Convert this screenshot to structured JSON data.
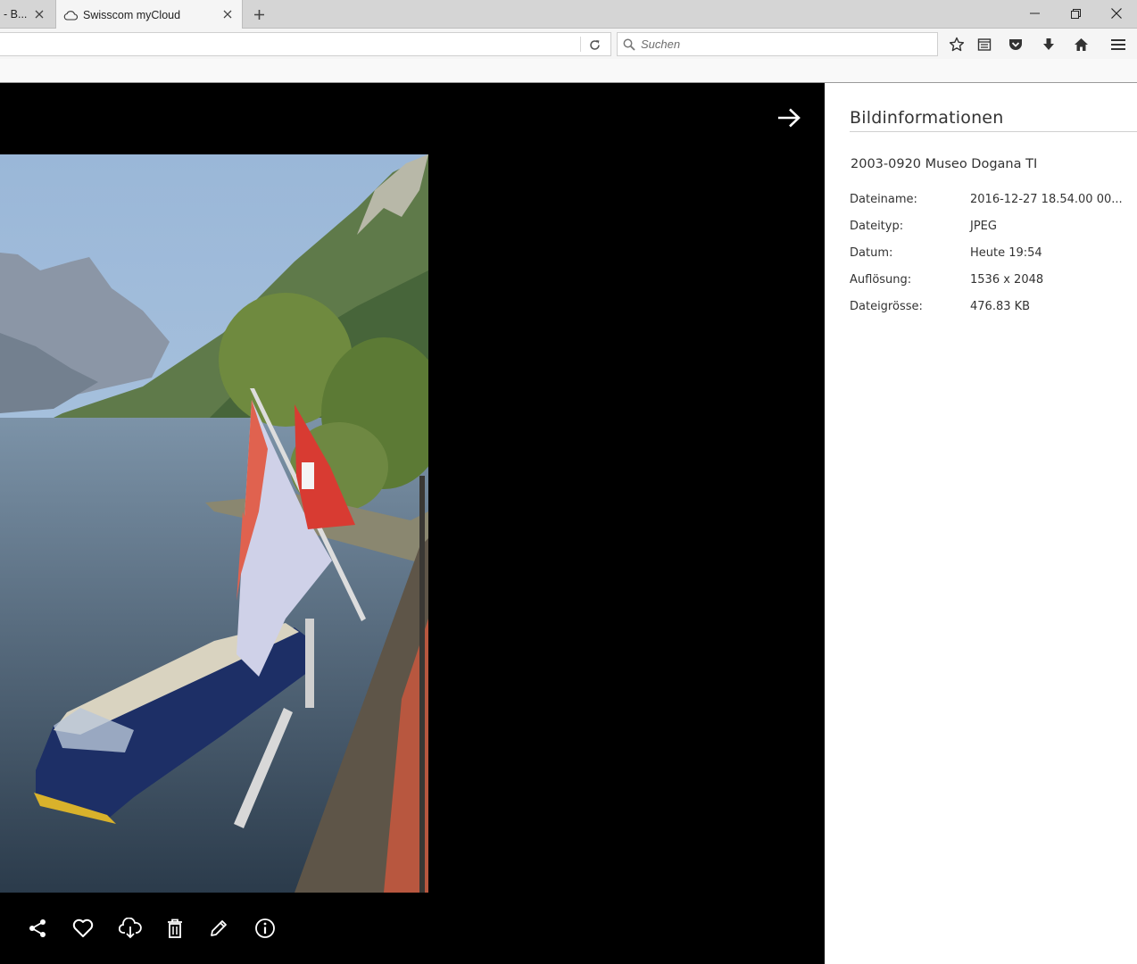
{
  "browser": {
    "tabs": [
      {
        "label": "- B...",
        "active": false
      },
      {
        "label": "Swisscom myCloud",
        "active": true
      }
    ],
    "search_placeholder": "Suchen"
  },
  "info_panel": {
    "title": "Bildinformationen",
    "file_title": "2003-0920 Museo Dogana TI",
    "rows": [
      {
        "key": "Dateiname:",
        "value": "2016-12-27 18.54.00 00..."
      },
      {
        "key": "Dateityp:",
        "value": "JPEG"
      },
      {
        "key": "Datum:",
        "value": "Heute 19:54"
      },
      {
        "key": "Auflösung:",
        "value": "1536 x 2048"
      },
      {
        "key": "Dateigrösse:",
        "value": "476.83 KB"
      }
    ]
  },
  "viewer_actions": [
    "share-icon",
    "heart-icon",
    "download-icon",
    "trash-icon",
    "pencil-icon",
    "info-icon"
  ],
  "colors": {
    "viewer_bg": "#000000",
    "panel_bg": "#ffffff"
  }
}
